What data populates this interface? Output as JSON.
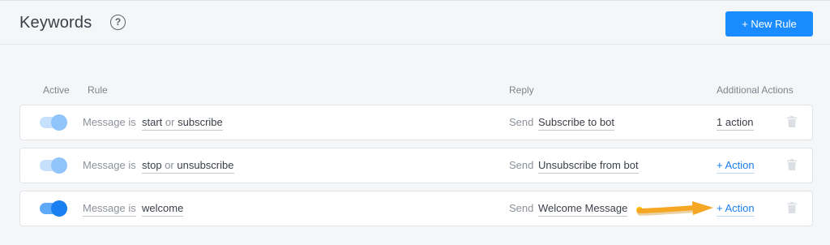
{
  "header": {
    "title": "Keywords",
    "help_symbol": "?",
    "new_rule_label": "+ New Rule"
  },
  "columns": {
    "active": "Active",
    "rule": "Rule",
    "reply": "Reply",
    "additional_actions": "Additional Actions"
  },
  "rows": [
    {
      "active": true,
      "rule_prefix": "Message is",
      "keyword_1": "start",
      "connector": "or",
      "keyword_2": "subscribe",
      "reply_prefix": "Send",
      "reply": "Subscribe to bot",
      "action": "1 action",
      "icon": "trash-icon"
    },
    {
      "active": true,
      "rule_prefix": "Message is",
      "keyword_1": "stop",
      "connector": "or",
      "keyword_2": "unsubscribe",
      "reply_prefix": "Send",
      "reply": "Unsubscribe from bot",
      "action": "+ Action",
      "icon": "trash-icon"
    },
    {
      "active": true,
      "rule_prefix": "Message is",
      "keyword_1": "welcome",
      "reply_prefix": "Send",
      "reply": "Welcome Message",
      "action": "+ Action",
      "icon": "trash-icon"
    }
  ],
  "colors": {
    "accent": "#1a8cff",
    "status_dot": "#ffbf00",
    "arrow": "#f5a623"
  }
}
